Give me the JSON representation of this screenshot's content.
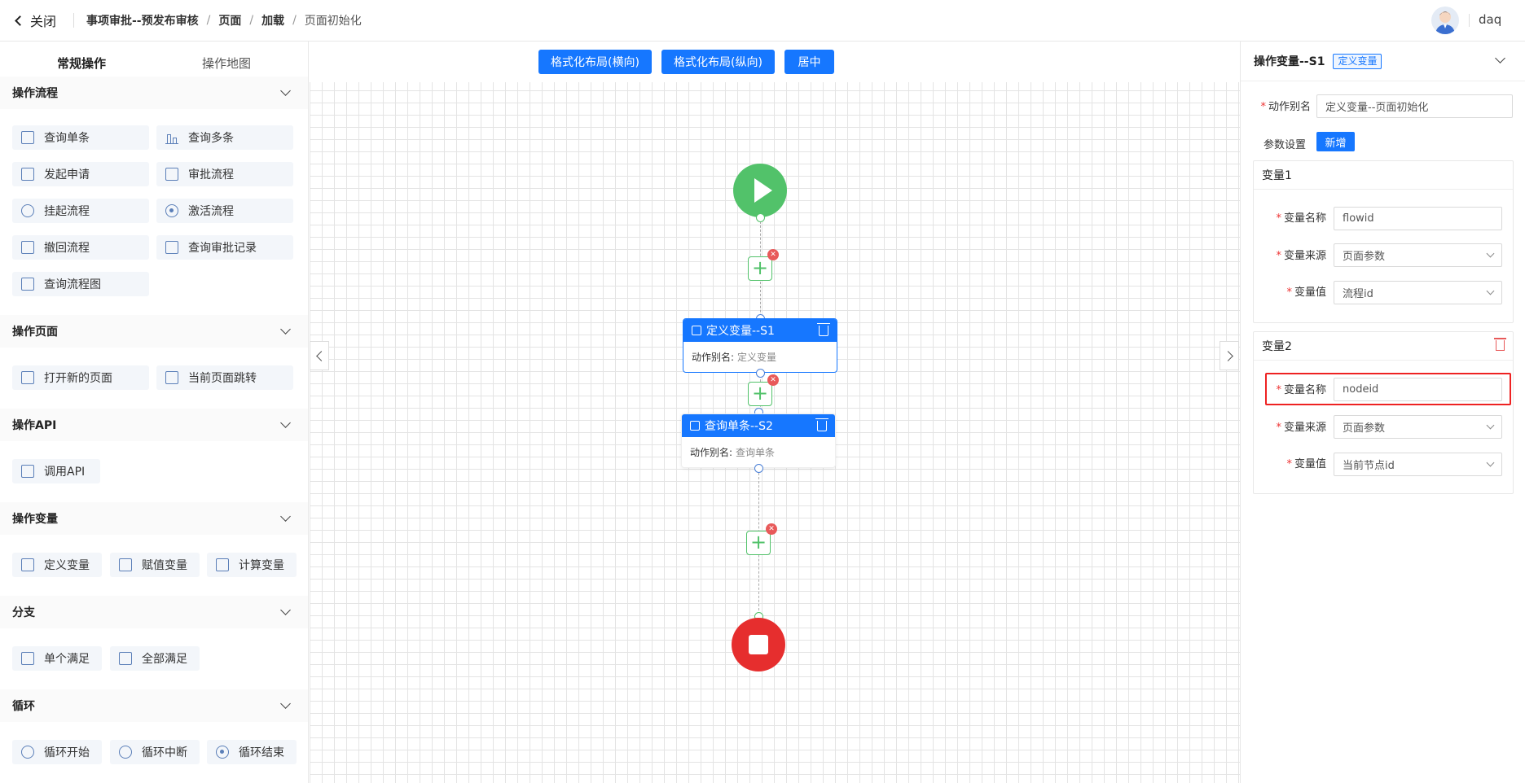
{
  "header": {
    "close_label": "关闭",
    "breadcrumb": [
      "事项审批--预发布审核",
      "页面",
      "加载",
      "页面初始化"
    ],
    "username": "daq"
  },
  "left": {
    "tabs": [
      "常规操作",
      "操作地图"
    ],
    "sections": [
      {
        "title": "操作流程",
        "items": [
          "查询单条",
          "查询多条",
          "发起申请",
          "审批流程",
          "挂起流程",
          "激活流程",
          "撤回流程",
          "查询审批记录",
          "查询流程图"
        ]
      },
      {
        "title": "操作页面",
        "items": [
          "打开新的页面",
          "当前页面跳转"
        ]
      },
      {
        "title": "操作API",
        "items": [
          "调用API"
        ]
      },
      {
        "title": "操作变量",
        "items": [
          "定义变量",
          "赋值变量",
          "计算变量"
        ]
      },
      {
        "title": "分支",
        "items": [
          "单个满足",
          "全部满足"
        ]
      },
      {
        "title": "循环",
        "items": [
          "循环开始",
          "循环中断",
          "循环结束"
        ]
      }
    ]
  },
  "canvas": {
    "toolbar": [
      "格式化布局(横向)",
      "格式化布局(纵向)",
      "居中"
    ],
    "nodes": [
      {
        "title": "定义变量--S1",
        "alias_label": "动作别名:",
        "alias_value": "定义变量"
      },
      {
        "title": "查询单条--S2",
        "alias_label": "动作别名:",
        "alias_value": "查询单条"
      }
    ]
  },
  "right": {
    "title": "操作变量--S1",
    "tag": "定义变量",
    "alias_label": "动作别名",
    "alias_value": "定义变量--页面初始化",
    "params_label": "参数设置",
    "add_label": "新增",
    "vars": [
      {
        "title": "变量1",
        "name_label": "变量名称",
        "name_value": "flowid",
        "source_label": "变量来源",
        "source_value": "页面参数",
        "value_label": "变量值",
        "value_value": "流程id"
      },
      {
        "title": "变量2",
        "name_label": "变量名称",
        "name_value": "nodeid",
        "source_label": "变量来源",
        "source_value": "页面参数",
        "value_label": "变量值",
        "value_value": "当前节点id"
      }
    ]
  },
  "colors": {
    "primary": "#1677ff",
    "start": "#52c26a",
    "end": "#e62e2e",
    "highlight": "#ee2222"
  }
}
